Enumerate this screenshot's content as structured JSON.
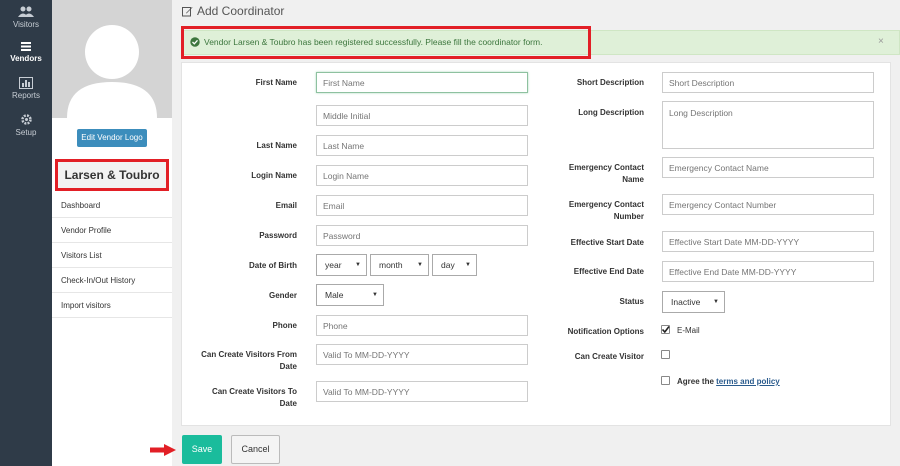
{
  "nav": {
    "items": [
      {
        "label": "Visitors",
        "icon": "users-icon"
      },
      {
        "label": "Vendors",
        "icon": "building-icon"
      },
      {
        "label": "Reports",
        "icon": "bar-chart-icon"
      },
      {
        "label": "Setup",
        "icon": "gear-icon"
      }
    ]
  },
  "sidebar": {
    "edit_logo_label": "Edit Vendor Logo",
    "vendor_name": "Larsen & Toubro",
    "menu": [
      "Dashboard",
      "Vendor Profile",
      "Visitors List",
      "Check-In/Out History",
      "Import visitors"
    ]
  },
  "page": {
    "title": "Add Coordinator",
    "alert": "Vendor Larsen & Toubro has been registered successfully. Please fill the coordinator form.",
    "alert_close": "×"
  },
  "form": {
    "first_name": {
      "label": "First Name",
      "placeholder": "First Name"
    },
    "middle_initial": {
      "placeholder": "Middle Initial"
    },
    "last_name": {
      "label": "Last Name",
      "placeholder": "Last Name"
    },
    "login_name": {
      "label": "Login Name",
      "placeholder": "Login Name"
    },
    "email": {
      "label": "Email",
      "placeholder": "Email"
    },
    "password": {
      "label": "Password",
      "placeholder": "Password"
    },
    "dob": {
      "label": "Date of Birth",
      "year": "year",
      "month": "month",
      "day": "day"
    },
    "gender": {
      "label": "Gender",
      "value": "Male"
    },
    "phone": {
      "label": "Phone",
      "placeholder": "Phone"
    },
    "can_create_from": {
      "label_1": "Can Create Visitors From",
      "label_2": "Date",
      "placeholder": "Valid To MM-DD-YYYY"
    },
    "can_create_to": {
      "label_1": "Can Create Visitors To",
      "label_2": "Date",
      "placeholder": "Valid To MM-DD-YYYY"
    },
    "short_desc": {
      "label": "Short Description",
      "placeholder": "Short Description"
    },
    "long_desc": {
      "label": "Long Description",
      "placeholder": "Long Description"
    },
    "emergency_name": {
      "label_1": "Emergency Contact",
      "label_2": "Name",
      "placeholder": "Emergency Contact Name"
    },
    "emergency_number": {
      "label_1": "Emergency Contact",
      "label_2": "Number",
      "placeholder": "Emergency Contact Number"
    },
    "start_date": {
      "label": "Effective Start Date",
      "placeholder": "Effective Start Date MM-DD-YYYY"
    },
    "end_date": {
      "label": "Effective End Date",
      "placeholder": "Effective End Date MM-DD-YYYY"
    },
    "status": {
      "label": "Status",
      "value": "Inactive"
    },
    "notification": {
      "label": "Notification Options",
      "option": "E-Mail"
    },
    "can_create_visitor": {
      "label": "Can Create Visitor"
    },
    "agree": {
      "prefix": "Agree the",
      "link": "terms and policy"
    }
  },
  "buttons": {
    "save": "Save",
    "cancel": "Cancel"
  },
  "colors": {
    "nav_bg": "#2f3b48",
    "save_bg": "#1abc9c",
    "alert_bg": "#dff0d8",
    "highlight": "#e21f26",
    "edit_logo_bg": "#3c8dbc"
  }
}
